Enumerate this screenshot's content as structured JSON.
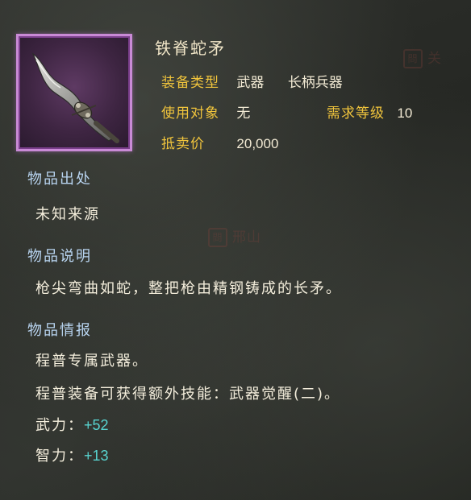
{
  "item": {
    "name": "铁脊蛇矛",
    "icon": "spear-icon",
    "frame_color": "#c98ad6"
  },
  "attributes": {
    "equip_type_label": "装备类型",
    "equip_type_value": "武器",
    "equip_subtype_value": "长柄兵器",
    "target_label": "使用对象",
    "target_value": "无",
    "level_req_label": "需求等级",
    "level_req_value": "10",
    "sell_price_label": "抵卖价",
    "sell_price_value": "20,000"
  },
  "sections": {
    "source_title": "物品出处",
    "source_text": "未知来源",
    "desc_title": "物品说明",
    "desc_text": "枪尖弯曲如蛇，整把枪由精钢铸成的长矛。",
    "info_title": "物品情报",
    "info_line1": "程普专属武器。",
    "info_line2": "程普装备可获得额外技能：武器觉醒(二)。"
  },
  "stats": [
    {
      "label": "武力：",
      "value": "+52"
    },
    {
      "label": "智力：",
      "value": "+13"
    }
  ],
  "background_marks": {
    "top_right": "关",
    "middle": "邢山"
  },
  "colors": {
    "label_gold": "#f0c43c",
    "section_blue": "#b8d4f0",
    "stat_cyan": "#58d3cf",
    "text_cream": "#f4eedc"
  }
}
